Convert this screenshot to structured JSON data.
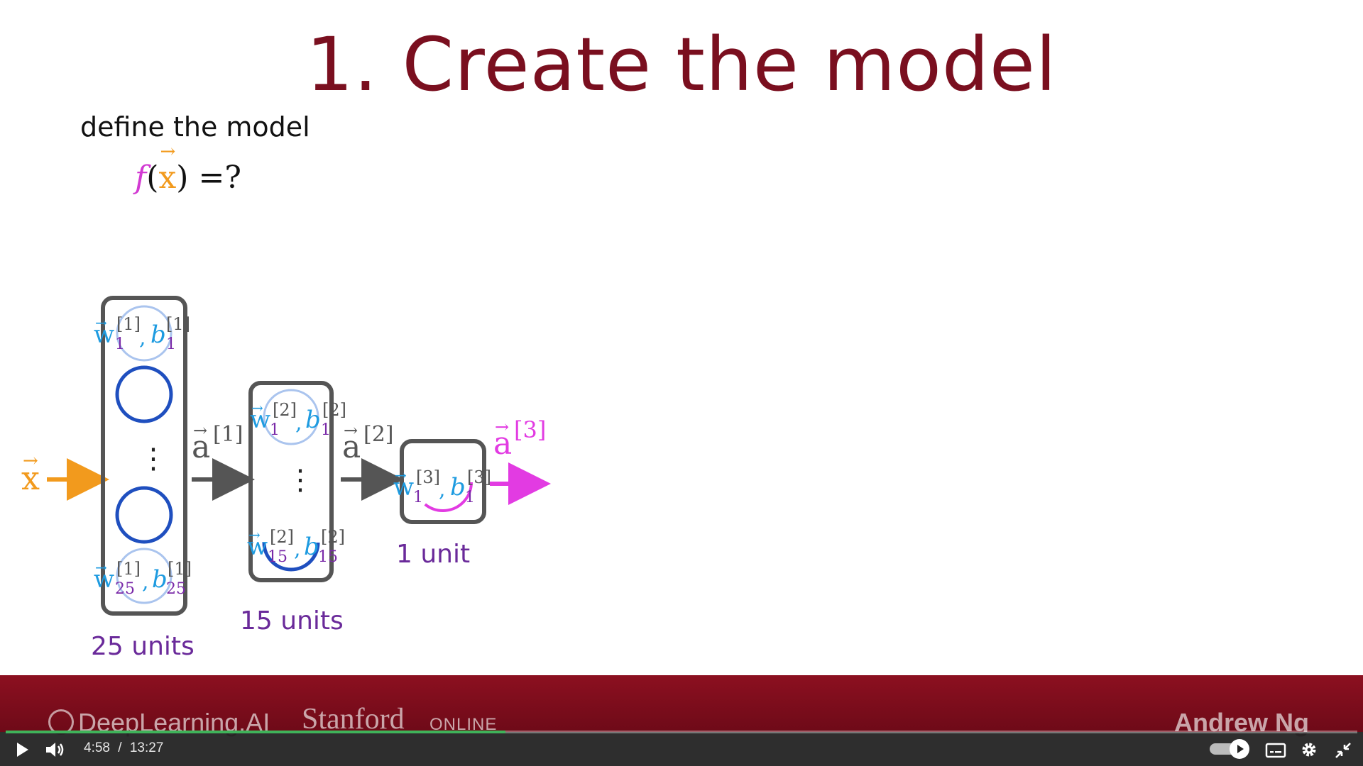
{
  "slide": {
    "title": "1. Create the model",
    "subtitle": "define the model",
    "formula": {
      "f": "f",
      "open": "(",
      "x": "x",
      "close": ") =?"
    }
  },
  "network": {
    "input_label": "x",
    "layer1": {
      "w_top": "w",
      "top_sup": "[1]",
      "top_sub": "1",
      "w_bot": "w",
      "bot_sup": "[1]",
      "bot_sub": "25",
      "b": "b",
      "units": "25 units"
    },
    "a1": "a",
    "a1_sup": "[1]",
    "layer2": {
      "w_top": "w",
      "top_sup": "[2]",
      "top_sub": "1",
      "w_bot": "w",
      "bot_sup": "[2]",
      "bot_sub": "15",
      "b": "b",
      "units": "15 units"
    },
    "a2": "a",
    "a2_sup": "[2]",
    "layer3": {
      "w": "w",
      "sup": "[3]",
      "sub": "1",
      "b": "b",
      "units": "1 unit"
    },
    "a3": "a",
    "a3_sup": "[3]",
    "colors": {
      "orange": "#f29a1d",
      "blue": "#1e9be0",
      "purple": "#7a2aa8",
      "magenta": "#e23be2",
      "neuron": "#1f4fbf",
      "gray": "#555555"
    }
  },
  "footer": {
    "brand1": "DeepLearning.AI",
    "brand2": "Stanford",
    "brand2b": "ONLINE",
    "author": "Andrew Ng"
  },
  "player": {
    "time_current": "4:58",
    "time_separator": "/",
    "time_total": "13:27",
    "progress": 0.37
  }
}
